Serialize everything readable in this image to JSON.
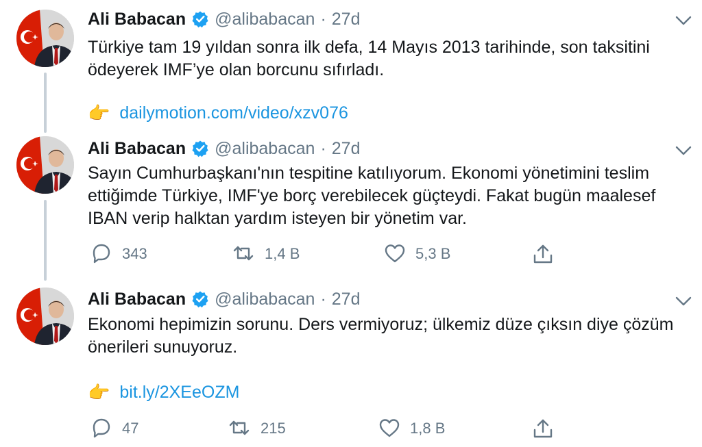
{
  "colors": {
    "link": "#1b95e0",
    "muted": "#657786",
    "verified": "#1da1f2"
  },
  "tweets": [
    {
      "name": "Ali Babacan",
      "handle": "@alibabacan",
      "dot": "·",
      "time": "27d",
      "text_lines": [
        "Türkiye tam 19 yıldan sonra ilk defa, 14 Mayıs 2013 tarihinde, son taksitini",
        "ödeyerek IMF’ye olan borcunu sıfırladı."
      ],
      "link_emoji": "👉",
      "link": "dailymotion.com/video/xzv076"
    },
    {
      "name": "Ali Babacan",
      "handle": "@alibabacan",
      "dot": "·",
      "time": "27d",
      "text_lines": [
        "Sayın Cumhurbaşkanı'nın tespitine katılıyorum. Ekonomi yönetimini teslim",
        "ettiğimde Türkiye, IMF'ye borç verebilecek güçteydi. Fakat bugün maalesef",
        "IBAN verip halktan yardım isteyen bir yönetim var."
      ],
      "replies": "343",
      "retweets": "1,4 B",
      "likes": "5,3 B"
    },
    {
      "name": "Ali Babacan",
      "handle": "@alibabacan",
      "dot": "·",
      "time": "27d",
      "text_lines": [
        "Ekonomi hepimizin sorunu. Ders vermiyoruz; ülkemiz düze çıksın diye çözüm",
        "önerileri sunuyoruz."
      ],
      "link_emoji": "👉",
      "link": "bit.ly/2XEeOZM",
      "replies": "47",
      "retweets": "215",
      "likes": "1,8 B"
    }
  ]
}
